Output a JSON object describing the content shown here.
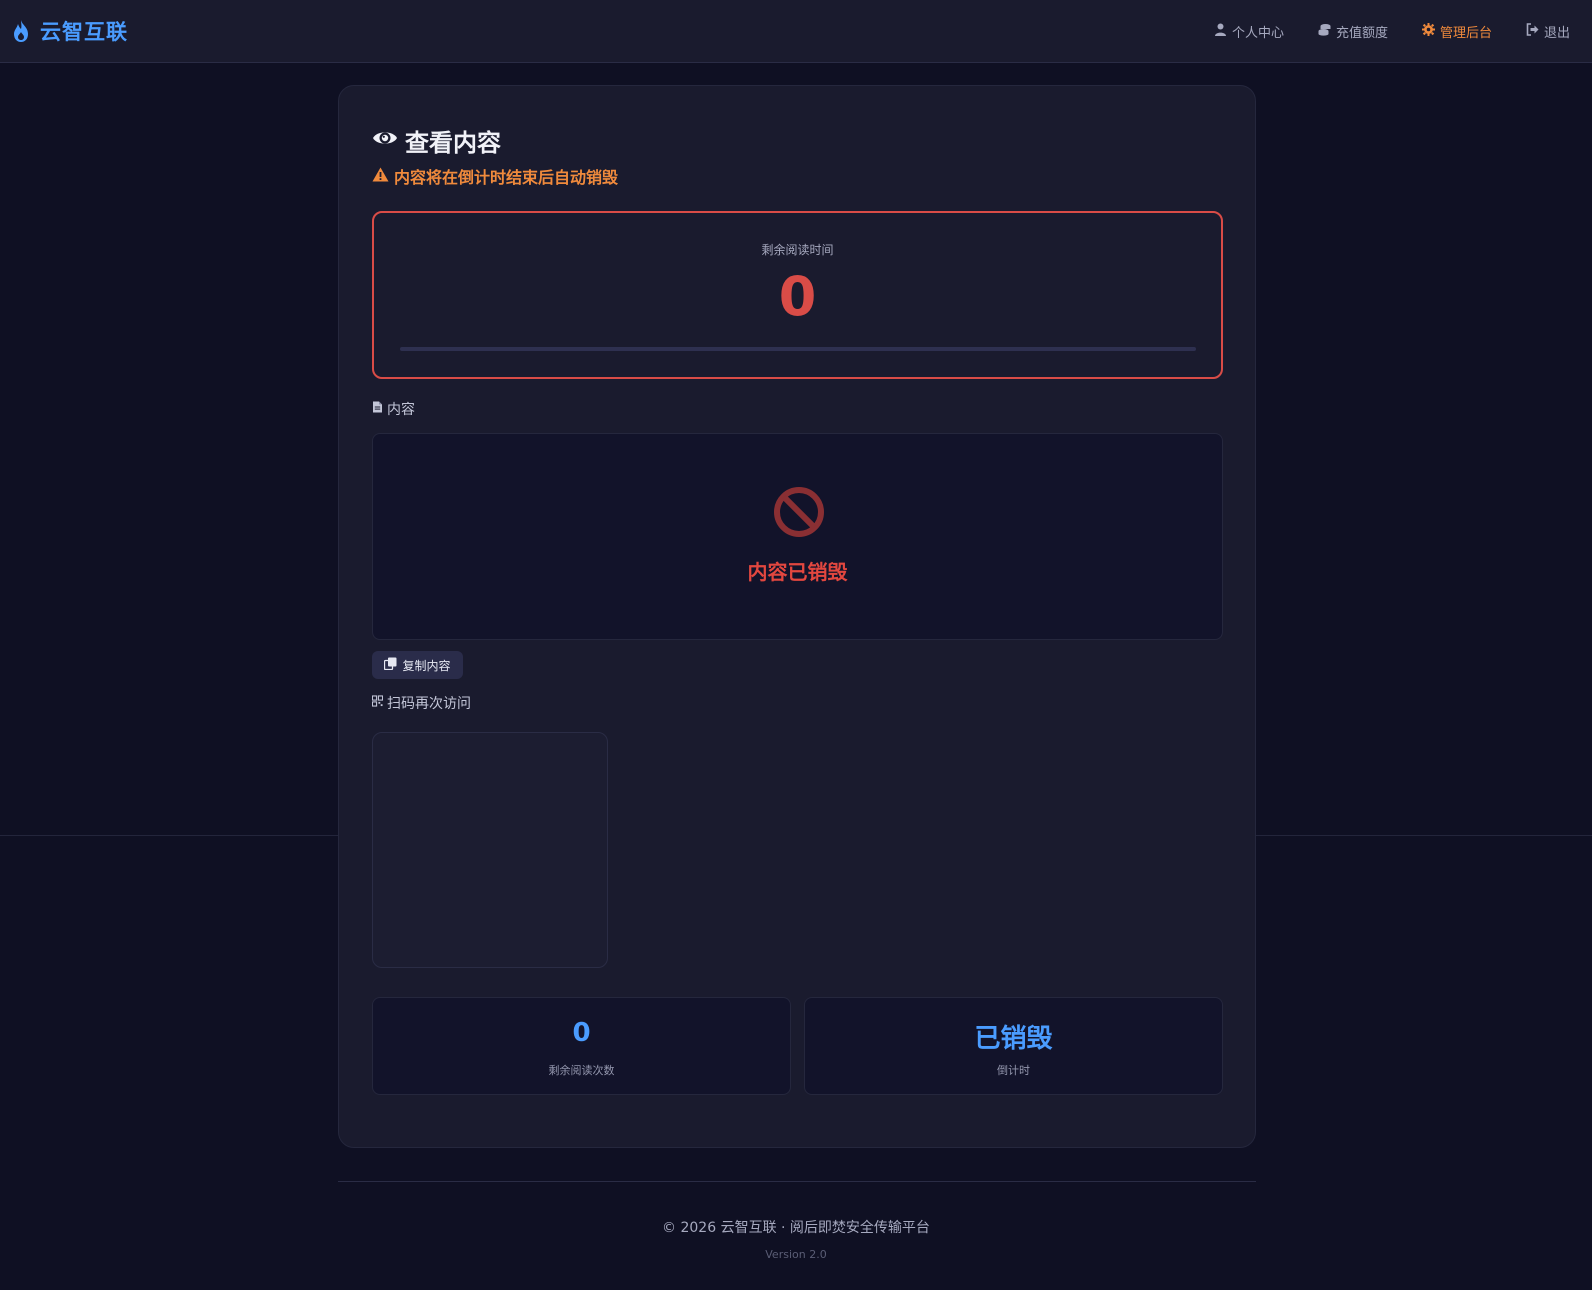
{
  "header": {
    "brand": "云智互联",
    "brand_color": "#4a9cff",
    "nav": [
      {
        "label": "个人中心",
        "icon": "user-icon"
      },
      {
        "label": "充值额度",
        "icon": "coins-icon"
      },
      {
        "label": "管理后台",
        "icon": "gear-icon",
        "active": true
      },
      {
        "label": "退出",
        "icon": "logout-icon"
      }
    ]
  },
  "page": {
    "title": "查看内容",
    "warning": "内容将在倒计时结束后自动销毁"
  },
  "timer": {
    "label": "剩余阅读时间",
    "value": "0",
    "progress": 0
  },
  "content": {
    "label": "内容",
    "status": "内容已销毁",
    "copy_label": "复制内容"
  },
  "qr": {
    "label": "扫码再次访问"
  },
  "stats": [
    {
      "value": "0",
      "label": "剩余阅读次数"
    },
    {
      "value": "已销毁",
      "label": "倒计时"
    }
  ],
  "footer": {
    "copyright": "© 2026 云智互联 · 阅后即焚安全传输平台",
    "version": "Version 2.0"
  },
  "colors": {
    "accent": "#4a9cff",
    "danger": "#d94c47",
    "warning": "#f08a3c"
  }
}
